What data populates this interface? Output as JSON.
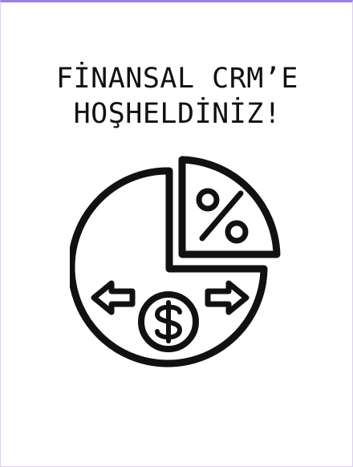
{
  "welcome": {
    "title_line1": "FİNANSAL CRM’E",
    "title_line2": "HOŞHELDİNİZ!"
  },
  "hero": {
    "icon": "finance-pie-chart-icon",
    "percent_symbol": "%",
    "currency_symbol": "$"
  },
  "colors": {
    "accent_border": "#9b7fe6",
    "ink": "#111111",
    "background": "#ffffff"
  }
}
